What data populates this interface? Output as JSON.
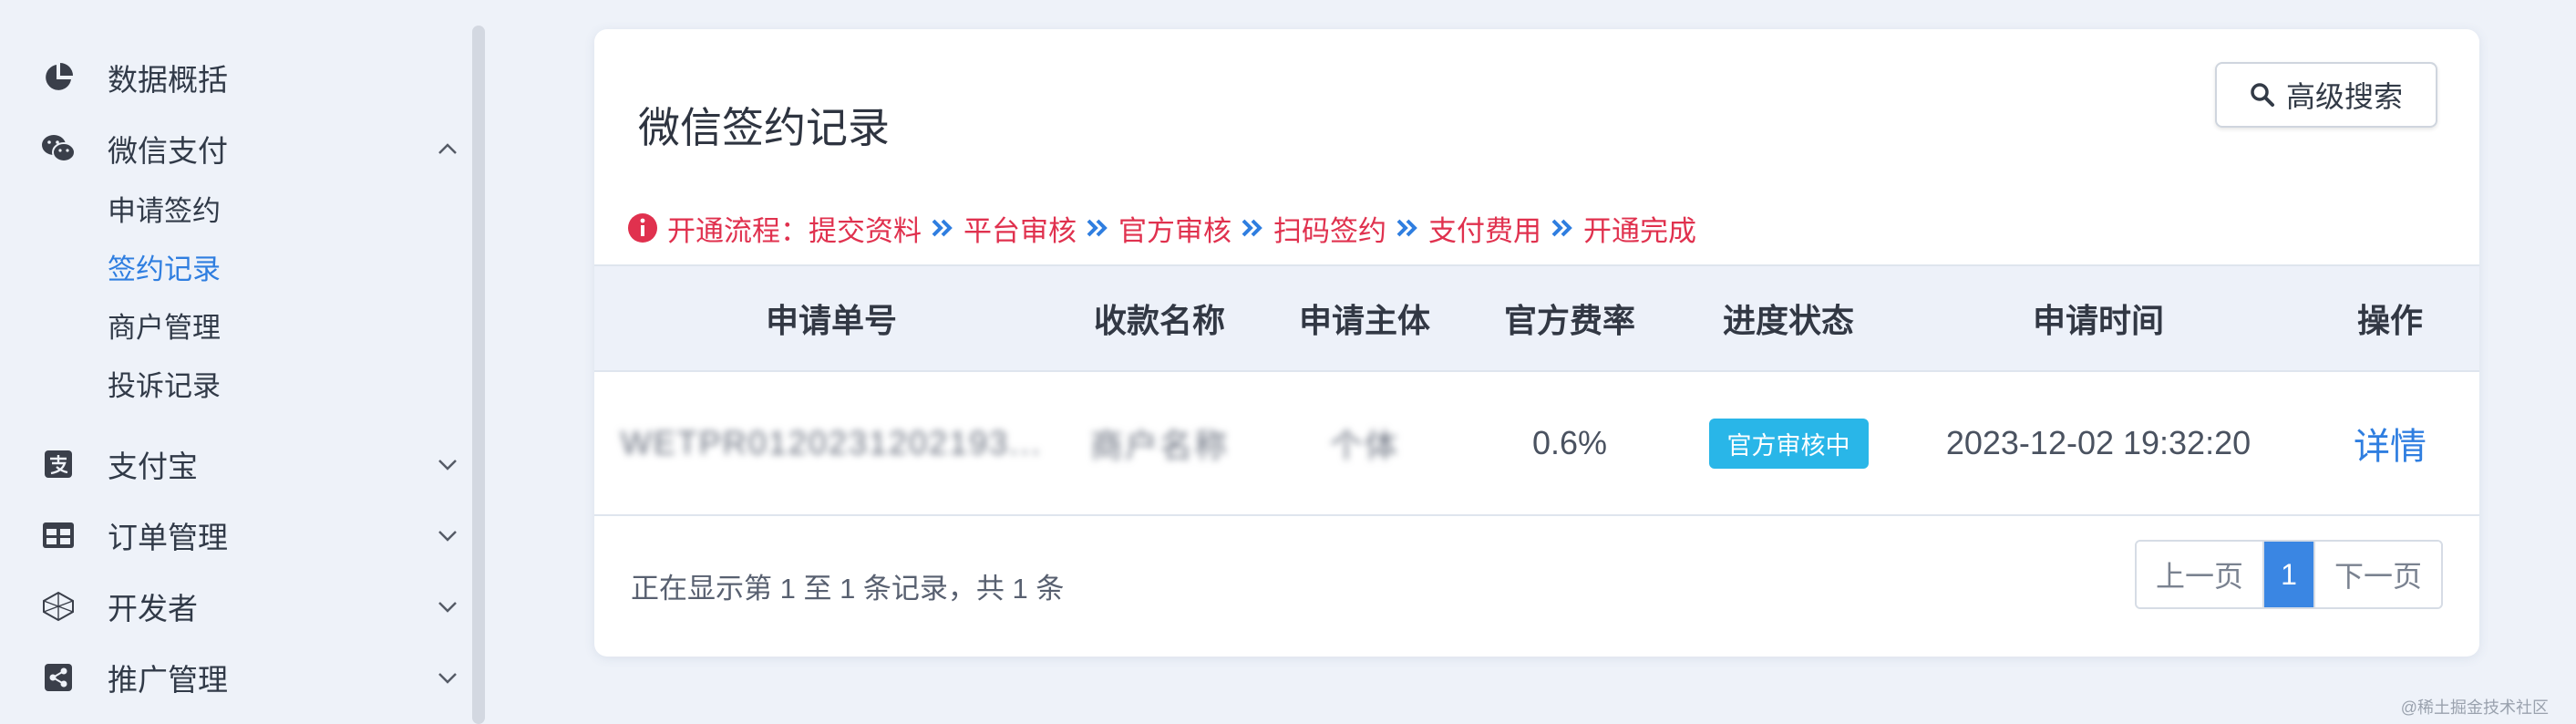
{
  "sidebar": {
    "items": [
      {
        "label": "数据概括",
        "icon": "pie-chart-icon"
      },
      {
        "label": "微信支付",
        "icon": "wechat-icon",
        "expanded": true,
        "children": [
          {
            "label": "申请签约",
            "active": false
          },
          {
            "label": "签约记录",
            "active": true
          },
          {
            "label": "商户管理",
            "active": false
          },
          {
            "label": "投诉记录",
            "active": false
          }
        ]
      },
      {
        "label": "支付宝",
        "icon": "alipay-icon",
        "expanded": false
      },
      {
        "label": "订单管理",
        "icon": "table-icon",
        "expanded": false
      },
      {
        "label": "开发者",
        "icon": "developer-icon",
        "expanded": false
      },
      {
        "label": "推广管理",
        "icon": "share-icon",
        "expanded": false
      }
    ]
  },
  "card": {
    "title": "微信签约记录",
    "search_button": "高级搜索",
    "flow": {
      "prefix": "开通流程：",
      "steps": [
        "提交资料",
        "平台审核",
        "官方审核",
        "扫码签约",
        "支付费用",
        "开通完成"
      ]
    },
    "table": {
      "headers": [
        "申请单号",
        "收款名称",
        "申请主体",
        "官方费率",
        "进度状态",
        "申请时间",
        "操作"
      ],
      "rows": [
        {
          "order_no": "WETPR0120231202193...",
          "payee_name": "商户名称",
          "subject": "个体",
          "rate": "0.6%",
          "status": "官方审核中",
          "time": "2023-12-02 19:32:20",
          "action": "详情"
        }
      ]
    },
    "footer": {
      "info": "正在显示第 1 至 1 条记录，共 1 条",
      "prev": "上一页",
      "current_page": "1",
      "next": "下一页"
    }
  },
  "watermark": "@稀土掘金技术社区",
  "colors": {
    "accent": "#2f7ee0",
    "flow_red": "#e0314e",
    "badge": "#29b6e8",
    "page_bg": "#eef2f9"
  }
}
